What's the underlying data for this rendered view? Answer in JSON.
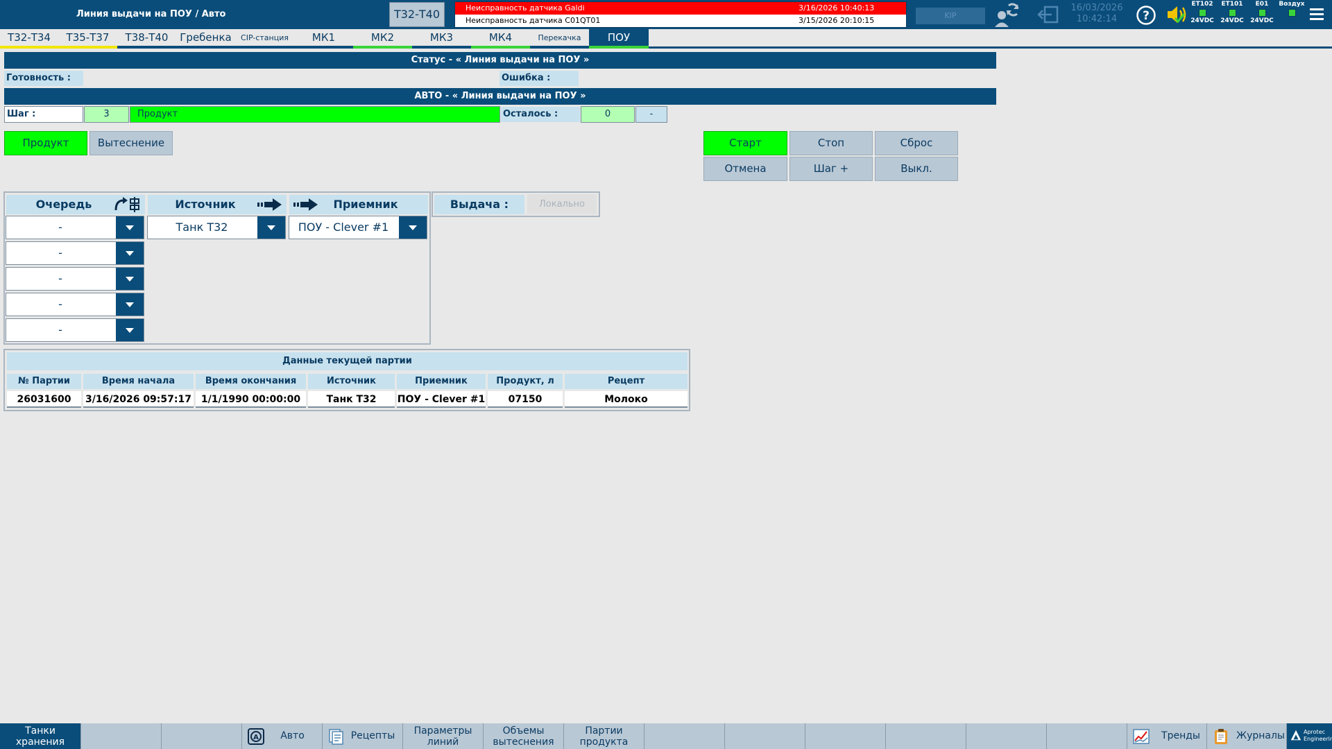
{
  "header": {
    "title": "Линия выдачи на ПОУ / Авто",
    "area_button": "Т32-Т40",
    "kip_label": "KIP",
    "date": "16/03/2026",
    "time": "10:42:14",
    "io_status": [
      {
        "name": "ET102",
        "label": "24VDC"
      },
      {
        "name": "ET101",
        "label": "24VDC"
      },
      {
        "name": "E01",
        "label": "24VDC"
      },
      {
        "name": "Воздух",
        "label": ""
      }
    ]
  },
  "alarms": [
    {
      "text": "Неисправность датчика Galdi",
      "time": "3/16/2026 10:40:13",
      "color": "#ff0000"
    },
    {
      "text": "Неисправность датчика C01QT01",
      "time": "3/15/2026 20:10:15",
      "color": "#ffffff"
    }
  ],
  "nav": {
    "tabs": [
      {
        "label": "Т32-Т34",
        "bar": "#f2e600"
      },
      {
        "label": "Т35-Т37",
        "bar": "#f2e600"
      },
      {
        "label": "Т38-Т40",
        "bar": "#0a4d7a"
      },
      {
        "label": "Гребенка",
        "bar": "#0a4d7a"
      },
      {
        "label": "CIP-станция",
        "bar": "#0a4d7a"
      },
      {
        "label": "МК1",
        "bar": "#0a4d7a"
      },
      {
        "label": "МК2",
        "bar": "#3ad43a"
      },
      {
        "label": "МК3",
        "bar": "#0a4d7a"
      },
      {
        "label": "МК4",
        "bar": "#3ad43a"
      },
      {
        "label": "Перекачка",
        "bar": "#0a4d7a"
      },
      {
        "label": "ПОУ",
        "bar": "#3ad43a"
      }
    ]
  },
  "status": {
    "title": "Статус - « Линия выдачи на ПОУ »",
    "ready_label": "Готовность :",
    "error_label": "Ошибка :"
  },
  "auto": {
    "title": "АВТО - « Линия выдачи на ПОУ »",
    "step_label": "Шаг :",
    "step_number": "3",
    "step_name": "Продукт",
    "remaining_label": "Осталось :",
    "remaining_value": "0",
    "remaining_unit": "-"
  },
  "modes": {
    "product": "Продукт",
    "displace": "Вытеснение"
  },
  "controls": {
    "start": "Старт",
    "stop": "Стоп",
    "reset": "Сброс",
    "cancel": "Отмена",
    "step_plus": "Шаг +",
    "off": "Выкл."
  },
  "selection": {
    "queue_header": "Очередь",
    "source_header": "Источник",
    "receiver_header": "Приемник",
    "issue_label": "Выдача :",
    "local_button": "Локально",
    "queue": [
      "-",
      "-",
      "-",
      "-",
      "-"
    ],
    "source": "Танк Т32",
    "receiver": "ПОУ - Clever #1"
  },
  "batch": {
    "title": "Данные текущей партии",
    "columns": [
      "№ Партии",
      "Время начала",
      "Время окончания",
      "Источник",
      "Приемник",
      "Продукт, л",
      "Рецепт"
    ],
    "row": [
      "26031600",
      "3/16/2026 09:57:17",
      "1/1/1990 00:00:00",
      "Танк Т32",
      "ПОУ - Clever #1",
      "07150",
      "Молоко"
    ]
  },
  "footer": {
    "tanks": "Танки хранения",
    "auto": "Авто",
    "recipes": "Рецепты",
    "line_params": "Параметры линий",
    "displace_volumes": "Объемы вытеснения",
    "product_batches": "Партии продукта",
    "trends": "Тренды",
    "journals": "Журналы",
    "brand": "Aprotec Engineering"
  }
}
